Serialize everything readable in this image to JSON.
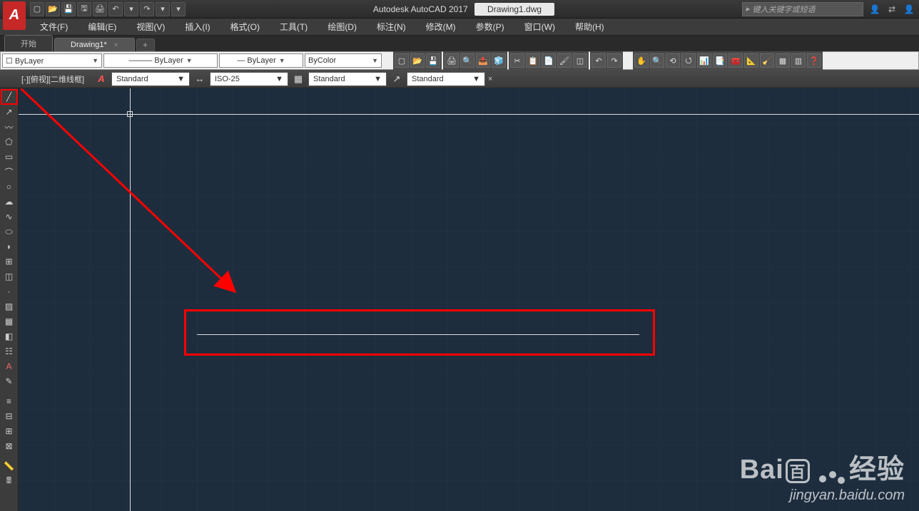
{
  "title": {
    "app": "Autodesk AutoCAD 2017",
    "file": "Drawing1.dwg"
  },
  "search": {
    "placeholder": "键入关键字或短语"
  },
  "menu": [
    "文件(F)",
    "编辑(E)",
    "视图(V)",
    "插入(I)",
    "格式(O)",
    "工具(T)",
    "绘图(D)",
    "标注(N)",
    "修改(M)",
    "参数(P)",
    "窗口(W)",
    "帮助(H)"
  ],
  "tabs": {
    "start": "开始",
    "drawing": "Drawing1*",
    "add": "+"
  },
  "properties": {
    "layer": "ByLayer",
    "linetype": "ByLayer",
    "lineweight": "ByLayer",
    "color": "ByColor"
  },
  "viewport_label": "[-][俯视][二维线框]",
  "styles": {
    "text": "Standard",
    "dim": "ISO-25",
    "table": "Standard",
    "mleader": "Standard"
  },
  "watermark": {
    "brand": "Bai",
    "brand2": "经验",
    "url": "jingyan.baidu.com"
  },
  "icons": {
    "dropdown": "▼",
    "close": "×",
    "search_icon": "🔍",
    "user": "👤",
    "swap": "⇄"
  }
}
